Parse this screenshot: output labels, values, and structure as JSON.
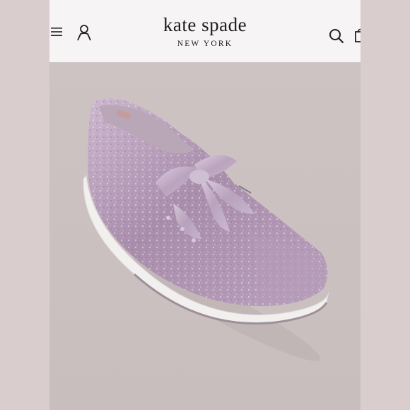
{
  "header": {
    "brand_name": "kate spade",
    "brand_location": "NEW YORK",
    "icons": {
      "menu": "menu-icon",
      "account": "account-icon",
      "search": "search-icon",
      "bag": "shopping-bag-icon"
    }
  },
  "product_image": {
    "subject": "lilac glitter sneaker with satin ribbon laces",
    "colors": {
      "glitter": "#b69ab8",
      "ribbon": "#c7b3c9",
      "sole": "#f2efef",
      "background": "#cbc1c1"
    }
  }
}
